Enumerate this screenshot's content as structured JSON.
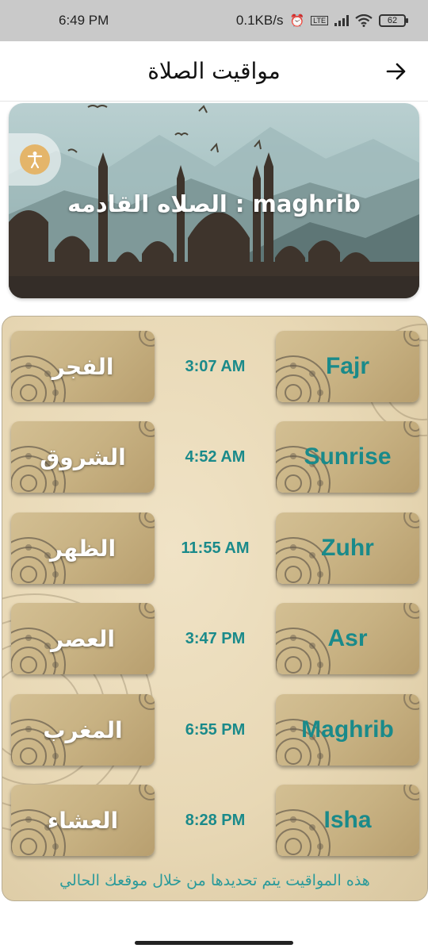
{
  "status_bar": {
    "time": "6:49 PM",
    "net_speed": "0.1KB/s",
    "battery": "62",
    "icons": [
      "alarm-icon",
      "volte-icon",
      "signal-icon",
      "wifi-icon",
      "battery-icon"
    ]
  },
  "app_bar": {
    "title": "مواقيت الصلاة",
    "back_icon": "arrow-right-icon"
  },
  "hero": {
    "next_prayer_text": "الصلاه القادمه  :  maghrib",
    "accessibility_icon": "accessibility-icon"
  },
  "prayers": [
    {
      "arabic": "الفجر",
      "time": "3:07 AM",
      "english": "Fajr"
    },
    {
      "arabic": "الشروق",
      "time": "4:52 AM",
      "english": "Sunrise"
    },
    {
      "arabic": "الظهر",
      "time": "11:55 AM",
      "english": "Zuhr"
    },
    {
      "arabic": "العصر",
      "time": "3:47 PM",
      "english": "Asr"
    },
    {
      "arabic": "المغرب",
      "time": "6:55 PM",
      "english": "Maghrib"
    },
    {
      "arabic": "العشاء",
      "time": "8:28 PM",
      "english": "Isha"
    }
  ],
  "footer_note": "هذه المواقيت يتم تحديدها من خلال موقعك الحالي",
  "colors": {
    "accent": "#1a8a8a",
    "tile": "#c8b283",
    "panel": "#e8d8b5"
  }
}
